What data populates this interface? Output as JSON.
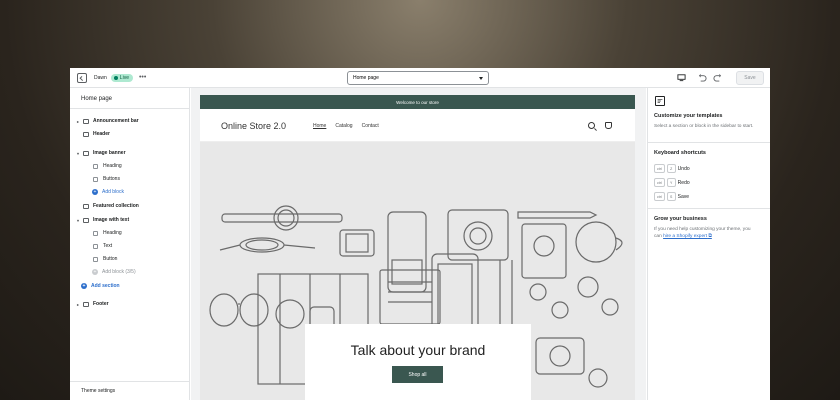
{
  "topbar": {
    "theme_name": "Dawn",
    "live_badge": "Live",
    "more": "•••",
    "page_select": "Home page",
    "save_label": "Save"
  },
  "sidebar": {
    "title": "Home page",
    "items": [
      {
        "label": "Announcement bar",
        "kind": "section",
        "toggle": "▸"
      },
      {
        "label": "Header",
        "kind": "section",
        "toggle": ""
      },
      {
        "label": "Image banner",
        "kind": "section",
        "toggle": "▾"
      },
      {
        "label": "Heading",
        "kind": "block"
      },
      {
        "label": "Buttons",
        "kind": "block"
      },
      {
        "label": "Add block",
        "kind": "add"
      },
      {
        "label": "Featured collection",
        "kind": "section",
        "toggle": ""
      },
      {
        "label": "Image with text",
        "kind": "section",
        "toggle": "▾"
      },
      {
        "label": "Heading",
        "kind": "block"
      },
      {
        "label": "Text",
        "kind": "block"
      },
      {
        "label": "Button",
        "kind": "block"
      },
      {
        "label": "Add block (3/5)",
        "kind": "add-disabled"
      },
      {
        "label": "Add section",
        "kind": "add-section"
      },
      {
        "label": "Footer",
        "kind": "section",
        "toggle": "▸"
      }
    ],
    "theme_settings": "Theme settings"
  },
  "preview": {
    "announcement": "Welcome to our store",
    "store_title": "Online Store 2.0",
    "nav": [
      "Home",
      "Catalog",
      "Contact"
    ],
    "banner_heading": "Talk about your brand",
    "shop_button": "Shop all"
  },
  "right_panel": {
    "customize_title": "Customize your templates",
    "customize_text": "Select a section or block in the sidebar to start.",
    "shortcuts_title": "Keyboard shortcuts",
    "shortcuts": [
      {
        "mod": "ctrl",
        "key": "Z",
        "label": "Undo"
      },
      {
        "mod": "ctrl",
        "key": "Y",
        "label": "Redo"
      },
      {
        "mod": "ctrl",
        "key": "S",
        "label": "Save"
      }
    ],
    "grow_title": "Grow your business",
    "grow_text": "If you need help customizing your theme, you can ",
    "grow_link": "hire a Shopify expert",
    "grow_link_suffix": " ⧉"
  },
  "colors": {
    "accent": "#3a5750",
    "link": "#2c6ecb",
    "live_badge": "#aee9d1"
  }
}
